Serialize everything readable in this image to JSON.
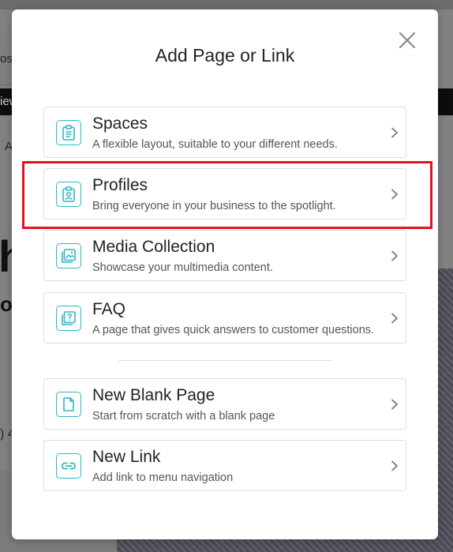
{
  "background": {
    "fragments": [
      "os:",
      "iew",
      "A",
      "h",
      "o",
      ") 4"
    ]
  },
  "modal": {
    "title": "Add Page or Link",
    "close_icon": "close-icon"
  },
  "options": [
    {
      "title": "Spaces",
      "description": "A flexible layout, suitable to your different needs.",
      "icon": "clipboard-list-icon"
    },
    {
      "title": "Profiles",
      "description": "Bring everyone in your business to the spotlight.",
      "icon": "profile-badge-icon"
    },
    {
      "title": "Media Collection",
      "description": "Showcase your multimedia content.",
      "icon": "image-gallery-icon"
    },
    {
      "title": "FAQ",
      "description": "A page that gives quick answers to customer questions.",
      "icon": "question-icon"
    },
    {
      "title": "New Blank Page",
      "description": "Start from scratch with a blank page",
      "icon": "blank-page-icon"
    },
    {
      "title": "New Link",
      "description": "Add link to menu navigation",
      "icon": "link-icon"
    }
  ],
  "colors": {
    "accent": "#2cb7c9",
    "highlight": "#e0141e"
  }
}
